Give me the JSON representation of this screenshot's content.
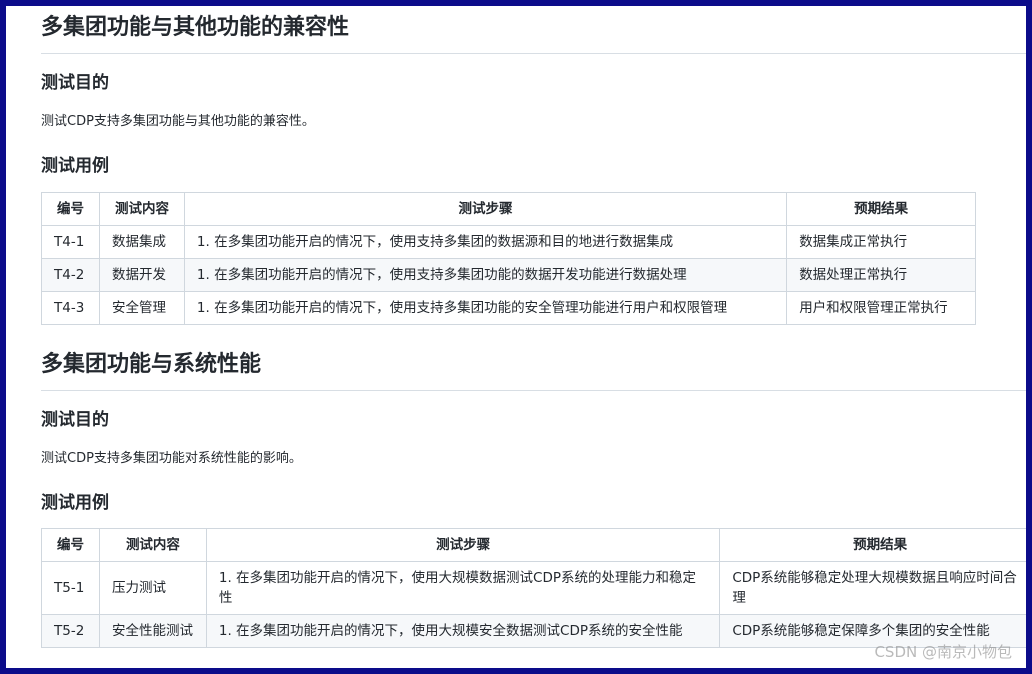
{
  "section1": {
    "heading": "多集团功能与其他功能的兼容性",
    "purpose_heading": "测试目的",
    "purpose_text": "测试CDP支持多集团功能与其他功能的兼容性。",
    "cases_heading": "测试用例",
    "table": {
      "headers": [
        "编号",
        "测试内容",
        "测试步骤",
        "预期结果"
      ],
      "rows": [
        [
          "T4-1",
          "数据集成",
          "1. 在多集团功能开启的情况下，使用支持多集团的数据源和目的地进行数据集成",
          "数据集成正常执行"
        ],
        [
          "T4-2",
          "数据开发",
          "1. 在多集团功能开启的情况下，使用支持多集团功能的数据开发功能进行数据处理",
          "数据处理正常执行"
        ],
        [
          "T4-3",
          "安全管理",
          "1. 在多集团功能开启的情况下，使用支持多集团功能的安全管理功能进行用户和权限管理",
          "用户和权限管理正常执行"
        ]
      ]
    }
  },
  "section2": {
    "heading": "多集团功能与系统性能",
    "purpose_heading": "测试目的",
    "purpose_text": "测试CDP支持多集团功能对系统性能的影响。",
    "cases_heading": "测试用例",
    "table": {
      "headers": [
        "编号",
        "测试内容",
        "测试步骤",
        "预期结果"
      ],
      "rows": [
        [
          "T5-1",
          "压力测试",
          "1. 在多集团功能开启的情况下，使用大规模数据测试CDP系统的处理能力和稳定性",
          "CDP系统能够稳定处理大规模数据且响应时间合理"
        ],
        [
          "T5-2",
          "安全性能测试",
          "1. 在多集团功能开启的情况下，使用大规模安全数据测试CDP系统的安全性能",
          "CDP系统能够稳定保障多个集团的安全性能"
        ]
      ]
    }
  },
  "watermark": "CSDN @南京小物包"
}
